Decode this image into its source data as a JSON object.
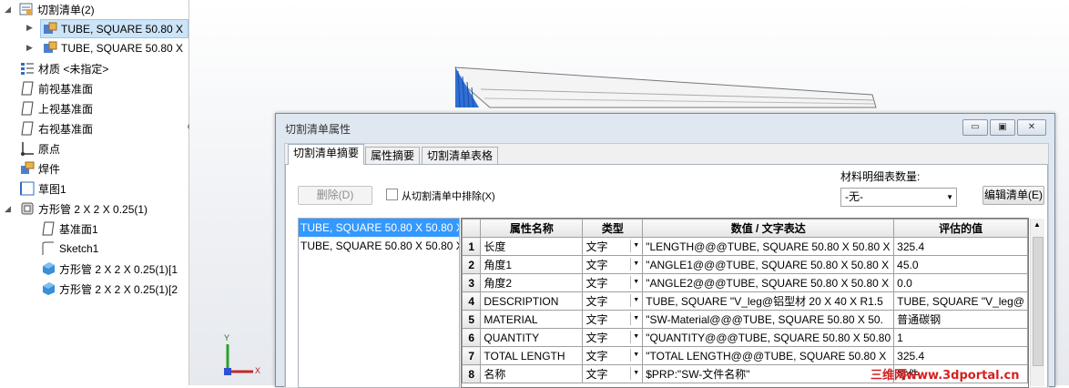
{
  "tree": {
    "items": [
      {
        "label": "切割清单(2)",
        "icon": "cutlist-folder-icon"
      },
      {
        "label": "TUBE, SQUARE 50.80 X",
        "icon": "cutlist-item-icon"
      },
      {
        "label": "TUBE, SQUARE 50.80 X",
        "icon": "cutlist-item-icon"
      },
      {
        "label": "材质 <未指定>",
        "icon": "material-icon"
      },
      {
        "label": "前视基准面",
        "icon": "plane-icon"
      },
      {
        "label": "上视基准面",
        "icon": "plane-icon"
      },
      {
        "label": "右视基准面",
        "icon": "plane-icon"
      },
      {
        "label": "原点",
        "icon": "origin-icon"
      },
      {
        "label": "焊件",
        "icon": "weldment-icon"
      },
      {
        "label": "草图1",
        "icon": "sketch-icon"
      },
      {
        "label": "方形管 2 X 2 X 0.25(1)",
        "icon": "structural-member-icon"
      },
      {
        "label": "基准面1",
        "icon": "plane-icon"
      },
      {
        "label": "Sketch1",
        "icon": "sketch-icon"
      },
      {
        "label": "方形管 2 X 2 X 0.25(1)[1",
        "icon": "solid-body-icon"
      },
      {
        "label": "方形管 2 X 2 X 0.25(1)[2",
        "icon": "solid-body-icon"
      }
    ]
  },
  "triad": {
    "x": "X",
    "y": "Y"
  },
  "dialog": {
    "title": "切割清单属性",
    "tabs": [
      "切割清单摘要",
      "属性摘要",
      "切割清单表格"
    ],
    "delete_button": "删除(D)",
    "exclude_checkbox": "从切割清单中排除(X)",
    "bom_qty_label": "材料明细表数量:",
    "bom_qty_value": "-无-",
    "edit_list_button": "编辑清单(E)",
    "list_items": [
      "TUBE, SQUARE 50.80 X 50.80 X 6.35",
      "TUBE, SQUARE 50.80 X 50.80 X 6.35"
    ],
    "grid": {
      "headers": [
        "属性名称",
        "类型",
        "数值 / 文字表达",
        "评估的值"
      ],
      "rows": [
        {
          "n": "1",
          "name": "长度",
          "type": "文字",
          "expr": "\"LENGTH@@@TUBE, SQUARE 50.80 X 50.80 X",
          "val": "325.4"
        },
        {
          "n": "2",
          "name": "角度1",
          "type": "文字",
          "expr": "\"ANGLE1@@@TUBE, SQUARE 50.80 X 50.80 X",
          "val": "45.0"
        },
        {
          "n": "3",
          "name": "角度2",
          "type": "文字",
          "expr": "\"ANGLE2@@@TUBE, SQUARE 50.80 X 50.80 X",
          "val": "0.0"
        },
        {
          "n": "4",
          "name": "DESCRIPTION",
          "type": "文字",
          "expr": "TUBE, SQUARE \"V_leg@铝型材 20 X 40 X R1.5",
          "val": "TUBE, SQUARE \"V_leg@"
        },
        {
          "n": "5",
          "name": "MATERIAL",
          "type": "文字",
          "expr": "\"SW-Material@@@TUBE, SQUARE 50.80 X 50.",
          "val": "普通碳钢"
        },
        {
          "n": "6",
          "name": "QUANTITY",
          "type": "文字",
          "expr": "\"QUANTITY@@@TUBE, SQUARE 50.80 X 50.80",
          "val": "1"
        },
        {
          "n": "7",
          "name": "TOTAL LENGTH",
          "type": "文字",
          "expr": "\"TOTAL LENGTH@@@TUBE, SQUARE 50.80 X",
          "val": "325.4"
        },
        {
          "n": "8",
          "name": "名称",
          "type": "文字",
          "expr": "$PRP:\"SW-文件名称\"",
          "val": "零件"
        }
      ]
    }
  },
  "watermark": "三维网www.3dportal.cn",
  "colors": {
    "selection": "#3399ff",
    "tube_blue": "#2f6fd6"
  }
}
